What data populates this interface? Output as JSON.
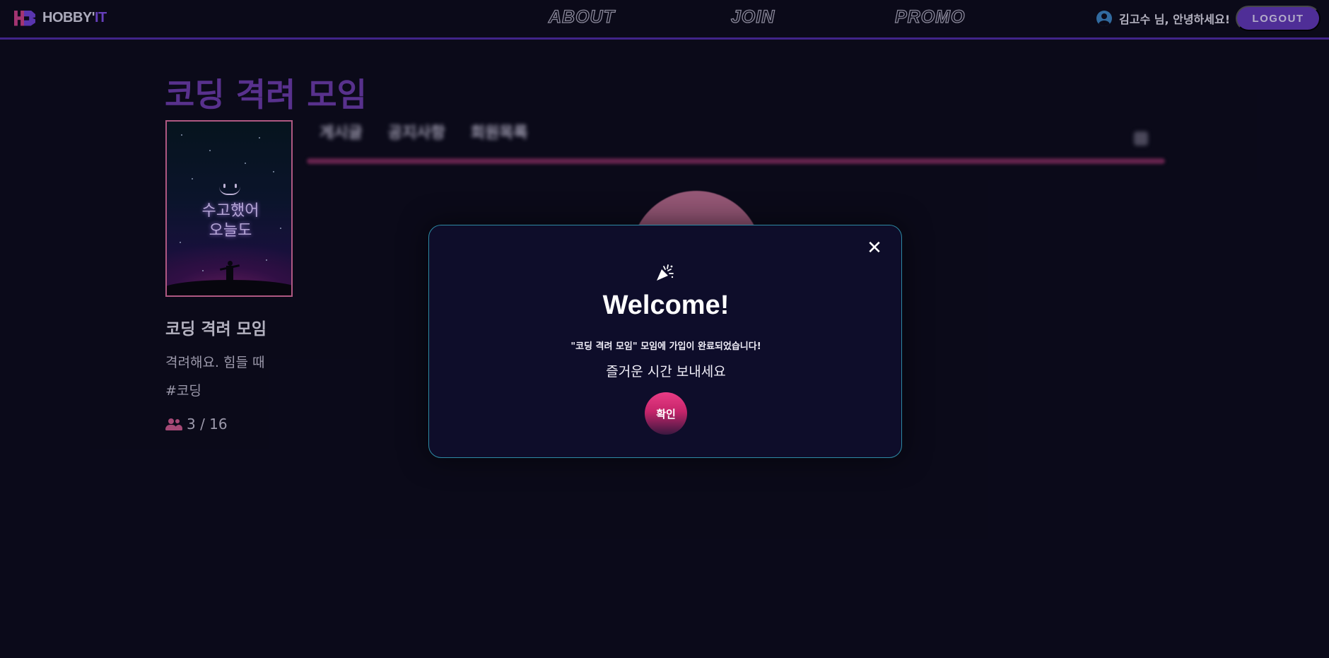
{
  "navbar": {
    "logo_text_a": "HOBBY'",
    "logo_text_b": "IT",
    "links": [
      "ABOUT",
      "JOIN",
      "PROMO"
    ],
    "greeting": "김고수 님, 안녕하세요!",
    "logout_label": "LOGOUT",
    "accent_color": "#5e36b4"
  },
  "group": {
    "page_title": "코딩 격려 모임",
    "poster_text_line1": "수고했어",
    "poster_text_line2": "오늘도",
    "name": "코딩 격려 모임",
    "description": "격려해요. 힘들 때",
    "tag": "#코딩",
    "members": "3 / 16",
    "members_icon": "people-icon"
  },
  "tabs": [
    "게시글",
    "공지사항",
    "회원목록"
  ],
  "modal": {
    "icon": "party-popper-icon",
    "title": "Welcome!",
    "message": "\"코딩 격려 모임\" 모임에 가입이 완료되었습니다!",
    "subtitle": "즐거운 시간 보내세요",
    "confirm_label": "확인",
    "close_symbol": "✕",
    "border_color": "#2d8aa4",
    "button_color": "#e93c86"
  }
}
